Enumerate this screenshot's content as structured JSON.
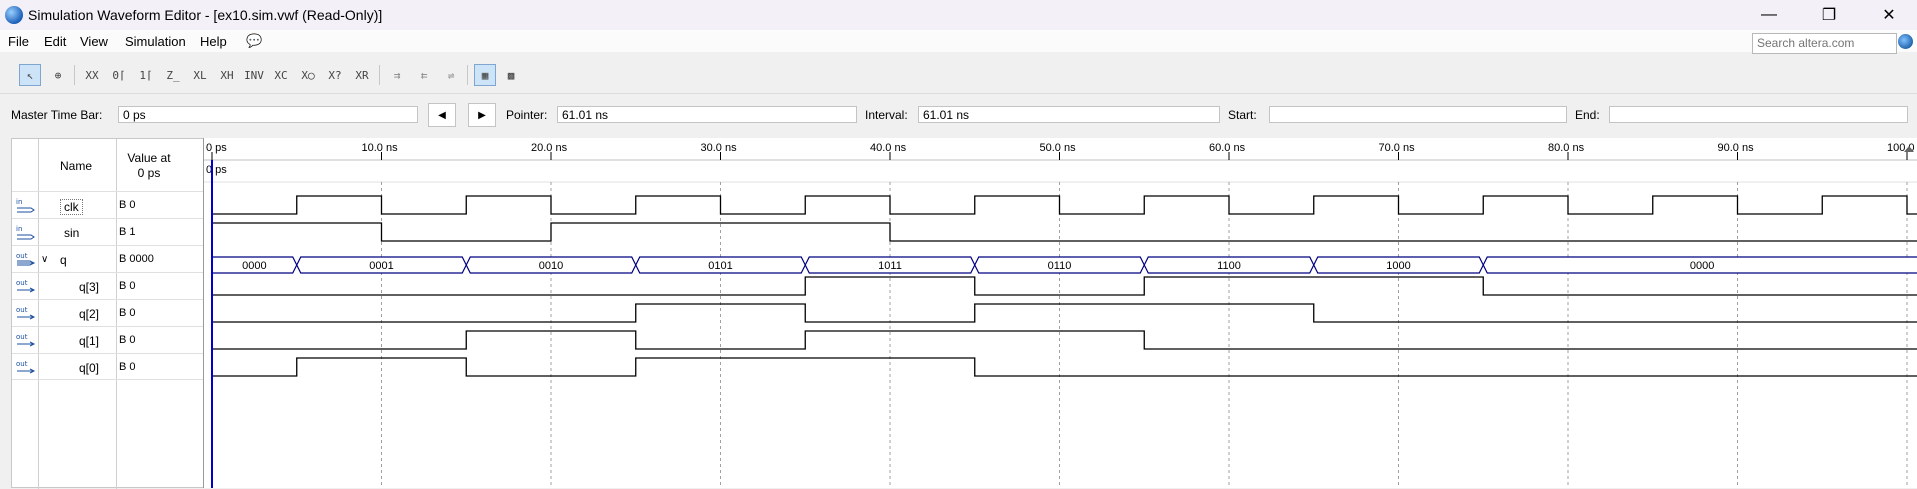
{
  "window": {
    "title": "Simulation Waveform Editor - [ex10.sim.vwf (Read-Only)]",
    "minimize_icon": "minimize-icon",
    "restore_icon": "restore-icon",
    "close_icon": "close-icon"
  },
  "menu": {
    "items": [
      "File",
      "Edit",
      "View",
      "Simulation",
      "Help"
    ],
    "search_placeholder": "Search altera.com"
  },
  "toolbar": {
    "icons": [
      "selection-tool-icon",
      "zoom-tool-icon",
      "force-unknown-icon",
      "force-low-icon",
      "force-high-icon",
      "force-high-impedance-icon",
      "force-weak-low-icon",
      "force-weak-high-icon",
      "invert-icon",
      "count-value-icon",
      "overwrite-clock-icon",
      "random-values-icon",
      "arbitrary-value-icon",
      "snap-to-grid-icon",
      "grid-settings-icon"
    ]
  },
  "timebar": {
    "master_label": "Master Time Bar:",
    "master_value": "0 ps",
    "pointer_label": "Pointer:",
    "pointer_value": "61.01 ns",
    "interval_label": "Interval:",
    "interval_value": "61.01 ns",
    "start_label": "Start:",
    "start_value": "",
    "end_label": "End:",
    "end_value": ""
  },
  "table": {
    "name_header": "Name",
    "value_header_line1": "Value at",
    "value_header_line2": "0 ps",
    "signals": [
      {
        "dir": "in",
        "name": "clk",
        "value": "B 0"
      },
      {
        "dir": "in",
        "name": "sin",
        "value": "B 1"
      },
      {
        "dir": "out",
        "name": "q",
        "value": "B 0000",
        "expanded": true
      },
      {
        "dir": "out",
        "name": "q[3]",
        "value": "B 0"
      },
      {
        "dir": "out",
        "name": "q[2]",
        "value": "B 0"
      },
      {
        "dir": "out",
        "name": "q[1]",
        "value": "B 0"
      },
      {
        "dir": "out",
        "name": "q[0]",
        "value": "B 0"
      }
    ]
  },
  "waveform": {
    "time_unit": "ns",
    "time_range": [
      0,
      100
    ],
    "ticks": [
      "0 ps",
      "10.0 ns",
      "20.0 ns",
      "30.0 ns",
      "40.0 ns",
      "50.0 ns",
      "60.0 ns",
      "70.0 ns",
      "80.0 ns",
      "90.0 ns",
      "100.0"
    ],
    "cursor_label": "0 ps",
    "clk": {
      "period_ns": 10,
      "first_rise_ns": 5,
      "initial": 0
    },
    "sin": [
      [
        0,
        1
      ],
      [
        10,
        0
      ],
      [
        20,
        1
      ],
      [
        40,
        0
      ]
    ],
    "bus_q": [
      {
        "start": 0,
        "end": 5,
        "label": "0000"
      },
      {
        "start": 5,
        "end": 15,
        "label": "0001"
      },
      {
        "start": 15,
        "end": 25,
        "label": "0010"
      },
      {
        "start": 25,
        "end": 35,
        "label": "0101"
      },
      {
        "start": 35,
        "end": 45,
        "label": "1011"
      },
      {
        "start": 45,
        "end": 55,
        "label": "0110"
      },
      {
        "start": 55,
        "end": 65,
        "label": "1100"
      },
      {
        "start": 65,
        "end": 75,
        "label": "1000"
      },
      {
        "start": 75,
        "end": 100,
        "label": "0000"
      }
    ],
    "bits": {
      "q3": [
        [
          0,
          0
        ],
        [
          35,
          1
        ],
        [
          45,
          0
        ],
        [
          55,
          1
        ],
        [
          75,
          0
        ]
      ],
      "q2": [
        [
          0,
          0
        ],
        [
          25,
          1
        ],
        [
          35,
          0
        ],
        [
          45,
          1
        ],
        [
          65,
          0
        ]
      ],
      "q1": [
        [
          0,
          0
        ],
        [
          15,
          1
        ],
        [
          25,
          0
        ],
        [
          35,
          1
        ],
        [
          55,
          0
        ]
      ],
      "q0": [
        [
          0,
          0
        ],
        [
          5,
          1
        ],
        [
          15,
          0
        ],
        [
          25,
          1
        ],
        [
          45,
          0
        ]
      ]
    },
    "colors": {
      "wave": "#000000",
      "bus": "#000080",
      "cursor": "#0000cc",
      "grid": "#a0a0a0"
    }
  }
}
